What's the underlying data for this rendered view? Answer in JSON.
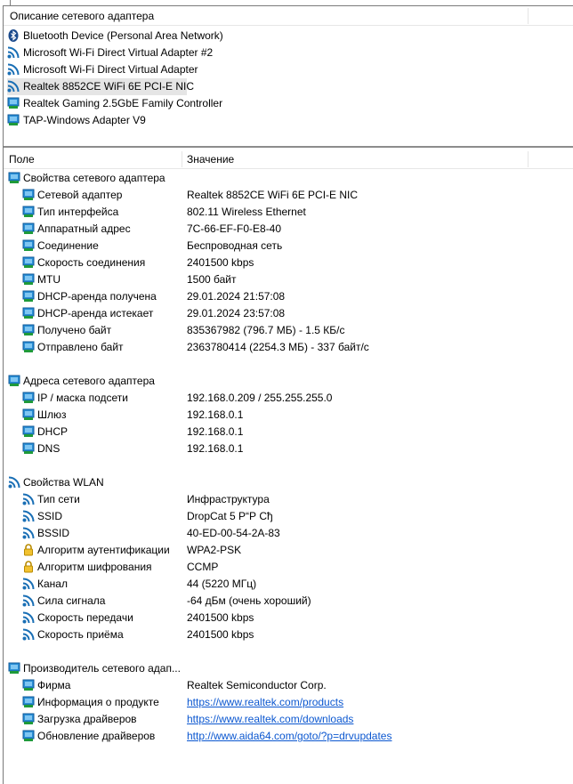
{
  "adapters_panel": {
    "header": "Описание сетевого адаптера",
    "items": [
      {
        "label": "Bluetooth Device (Personal Area Network)",
        "icon": "bluetooth-icon"
      },
      {
        "label": "Microsoft Wi-Fi Direct Virtual Adapter #2",
        "icon": "wifi-icon"
      },
      {
        "label": "Microsoft Wi-Fi Direct Virtual Adapter",
        "icon": "wifi-icon"
      },
      {
        "label": "Realtek 8852CE WiFi 6E PCI-E NIC",
        "icon": "wifi-icon",
        "selected": true
      },
      {
        "label": "Realtek Gaming 2.5GbE Family Controller",
        "icon": "network-adapter-icon"
      },
      {
        "label": "TAP-Windows Adapter V9",
        "icon": "network-adapter-icon"
      }
    ]
  },
  "details_panel": {
    "col_field": "Поле",
    "col_value": "Значение",
    "groups": [
      {
        "title": "Свойства сетевого адаптера",
        "rows": [
          {
            "field": "Сетевой адаптер",
            "value": "Realtek 8852CE WiFi 6E PCI-E NIC"
          },
          {
            "field": "Тип интерфейса",
            "value": "802.11 Wireless Ethernet"
          },
          {
            "field": "Аппаратный адрес",
            "value": "7C-66-EF-F0-E8-40"
          },
          {
            "field": "Соединение",
            "value": "Беспроводная сеть"
          },
          {
            "field": "Скорость соединения",
            "value": "2401500 kbps"
          },
          {
            "field": "MTU",
            "value": "1500 байт"
          },
          {
            "field": "DHCP-аренда получена",
            "value": "29.01.2024 21:57:08"
          },
          {
            "field": "DHCP-аренда истекает",
            "value": "29.01.2024 23:57:08"
          },
          {
            "field": "Получено байт",
            "value": "835367982 (796.7 МБ) - 1.5 КБ/с"
          },
          {
            "field": "Отправлено байт",
            "value": "2363780414 (2254.3 МБ) - 337 байт/с"
          }
        ]
      },
      {
        "title": "Адреса сетевого адаптера",
        "rows": [
          {
            "field": "IP / маска подсети",
            "value": "192.168.0.209 / 255.255.255.0"
          },
          {
            "field": "Шлюз",
            "value": "192.168.0.1"
          },
          {
            "field": "DHCP",
            "value": "192.168.0.1"
          },
          {
            "field": "DNS",
            "value": "192.168.0.1"
          }
        ]
      },
      {
        "title": "Свойства WLAN",
        "rows": [
          {
            "field": "Тип сети",
            "value": "Инфраструктура"
          },
          {
            "field": "SSID",
            "value": "DropCat 5 Р“Р Сђ"
          },
          {
            "field": "BSSID",
            "value": "40-ED-00-54-2A-83"
          },
          {
            "field": "Алгоритм аутентификации",
            "value": "WPA2-PSK"
          },
          {
            "field": "Алгоритм шифрования",
            "value": "CCMP"
          },
          {
            "field": "Канал",
            "value": "44 (5220 МГц)"
          },
          {
            "field": "Сила сигнала",
            "value": "-64 дБм (очень хороший)"
          },
          {
            "field": "Скорость передачи",
            "value": "2401500 kbps"
          },
          {
            "field": "Скорость приёма",
            "value": "2401500 kbps"
          }
        ]
      },
      {
        "title": "Производитель сетевого адап...",
        "rows": [
          {
            "field": "Фирма",
            "value": "Realtek Semiconductor Corp."
          },
          {
            "field": "Информация о продукте",
            "value": "https://www.realtek.com/products"
          },
          {
            "field": "Загрузка драйверов",
            "value": "https://www.realtek.com/downloads"
          },
          {
            "field": "Обновление драйверов",
            "value": "http://www.aida64.com/goto/?p=drvupdates"
          }
        ]
      }
    ]
  }
}
